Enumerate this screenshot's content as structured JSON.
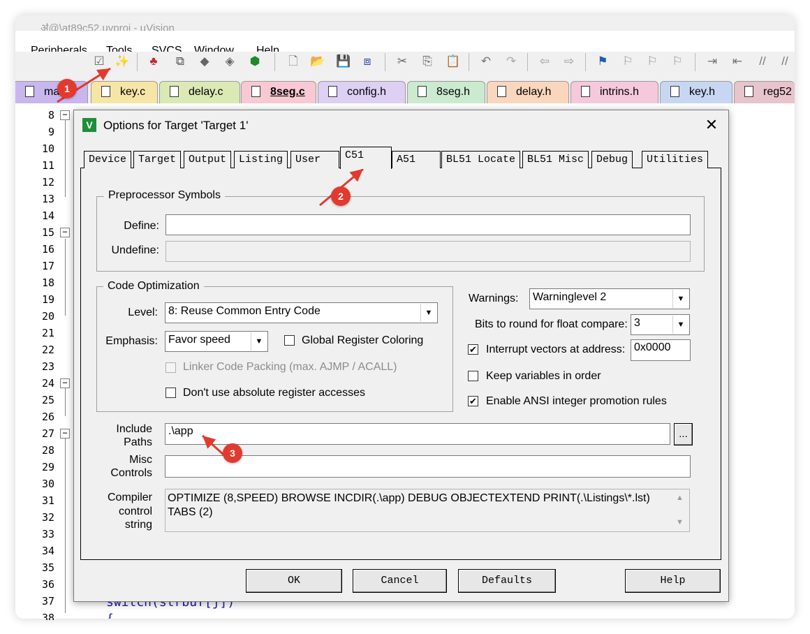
{
  "window_title": "ॳ@\\at89c52.uvproj - µVision",
  "menu": [
    "Peripherals",
    "Tools",
    "SVCS",
    "Window",
    "Help"
  ],
  "toolbar_icons": [
    "magic-wand-icon",
    "load-icon",
    "translate-icon",
    "diamond-icon",
    "diamond2-icon",
    "project-icon",
    "new-file-icon",
    "open-icon",
    "save-icon",
    "save-all-icon",
    "cut-icon",
    "copy-icon",
    "paste-icon",
    "undo-icon",
    "redo-icon",
    "back-icon",
    "forward-icon",
    "bookmark-icon",
    "bookmark-prev-icon",
    "bookmark-next-icon",
    "bookmark-clear-icon",
    "indent-icon",
    "unindent-icon",
    "comment-icon",
    "uncomment-icon"
  ],
  "file_tabs": [
    {
      "label": "mai",
      "color": "#c9b6ef",
      "active": false
    },
    {
      "label": "key.c",
      "color": "#f6e6a6",
      "active": false
    },
    {
      "label": "delay.c",
      "color": "#dbe9b5",
      "active": false
    },
    {
      "label": "8seg.c",
      "color": "#f8c9d2",
      "active": true
    },
    {
      "label": "config.h",
      "color": "#ddd0f2",
      "active": false
    },
    {
      "label": "8seg.h",
      "color": "#cbead0",
      "active": false
    },
    {
      "label": "delay.h",
      "color": "#f9d7bd",
      "active": false
    },
    {
      "label": "intrins.h",
      "color": "#f5c9db",
      "active": false
    },
    {
      "label": "key.h",
      "color": "#c7d7f2",
      "active": false
    },
    {
      "label": "reg52",
      "color": "#e8c4cc",
      "active": false
    }
  ],
  "line_numbers": [
    "8",
    "9",
    "10",
    "11",
    "12",
    "13",
    "14",
    "15",
    "16",
    "17",
    "18",
    "19",
    "20",
    "21",
    "22",
    "23",
    "24",
    "25",
    "26",
    "27",
    "28",
    "29",
    "30",
    "31",
    "32",
    "33",
    "34",
    "35",
    "36",
    "37",
    "38"
  ],
  "code_visible": {
    "line37": "switch(strbuf[j])",
    "line38": "{"
  },
  "dialog": {
    "title": "Options for Target 'Target 1'",
    "close": "✕",
    "tabs": [
      "Device",
      "Target",
      "Output",
      "Listing",
      "User",
      "C51",
      "A51",
      "BL51 Locate",
      "BL51 Misc",
      "Debug",
      "Utilities"
    ],
    "active_tab": "C51",
    "preprocessor": {
      "group_label": "Preprocessor Symbols",
      "define_label": "Define:",
      "define_value": "",
      "undefine_label": "Undefine:",
      "undefine_value": ""
    },
    "optimization": {
      "group_label": "Code Optimization",
      "level_label": "Level:",
      "level_value": "8: Reuse Common Entry Code",
      "emphasis_label": "Emphasis:",
      "emphasis_value": "Favor speed",
      "global_register_coloring": {
        "label": "Global Register Coloring",
        "checked": false
      },
      "linker_code_packing": {
        "label": "Linker Code Packing (max. AJMP / ACALL)",
        "checked": false,
        "disabled": true
      },
      "no_absolute_register": {
        "label": "Don't use absolute register accesses",
        "checked": false
      }
    },
    "right": {
      "warnings_label": "Warnings:",
      "warnings_value": "Warninglevel 2",
      "bits_label": "Bits to round for float compare:",
      "bits_value": "3",
      "interrupt_vectors": {
        "label": "Interrupt vectors at address:",
        "checked": true,
        "value": "0x0000"
      },
      "keep_variables": {
        "label": "Keep variables in order",
        "checked": false
      },
      "ansi_promotion": {
        "label": "Enable ANSI integer promotion rules",
        "checked": true
      }
    },
    "include_paths": {
      "label_line1": "Include",
      "label_line2": "Paths",
      "value": ".\\app",
      "browse": "..."
    },
    "misc_controls": {
      "label_line1": "Misc",
      "label_line2": "Controls",
      "value": ""
    },
    "compiler_control": {
      "label_line1": "Compiler",
      "label_line2": "control",
      "label_line3": "string",
      "value": "OPTIMIZE (8,SPEED) BROWSE INCDIR(.\\app) DEBUG OBJECTEXTEND PRINT(.\\Listings\\*.lst) TABS (2)"
    },
    "buttons": {
      "ok": "OK",
      "cancel": "Cancel",
      "defaults": "Defaults",
      "help": "Help"
    }
  },
  "annotations": [
    "1",
    "2",
    "3"
  ],
  "accent_color": "#e23a2e"
}
